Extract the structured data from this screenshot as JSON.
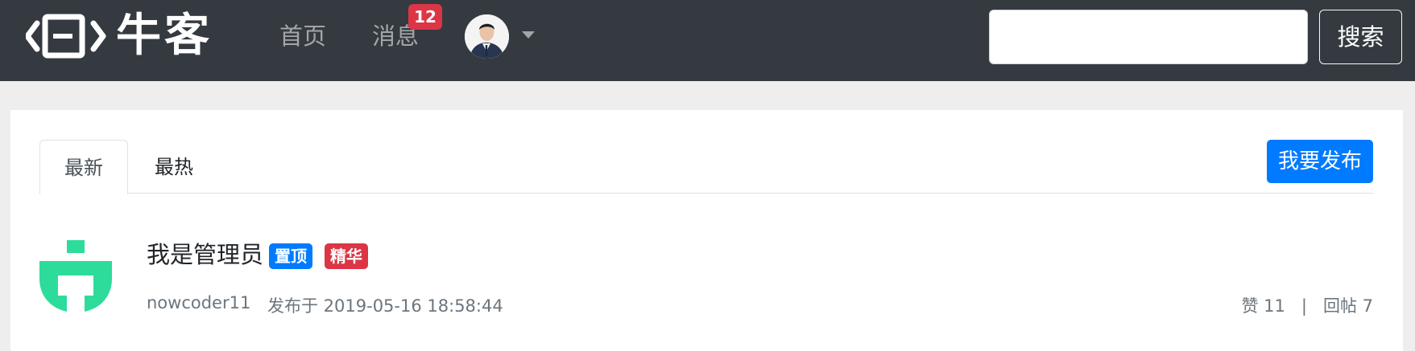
{
  "navbar": {
    "brand_text": "牛客",
    "links": [
      {
        "label": "首页"
      },
      {
        "label": "消息",
        "badge": "12"
      }
    ],
    "search": {
      "value": "",
      "placeholder": "",
      "button_label": "搜索"
    }
  },
  "tabs": [
    {
      "label": "最新",
      "active": true
    },
    {
      "label": "最热",
      "active": false
    }
  ],
  "publish_button": "我要发布",
  "post": {
    "title": "我是管理员",
    "tags": [
      "置顶",
      "精华"
    ],
    "author": "nowcoder11",
    "time": "发布于 2019-05-16 18:58:44",
    "likes": "赞 11",
    "separator": "|",
    "replies": "回帖 7"
  },
  "colors": {
    "navbar_bg": "#343a40",
    "primary": "#007bff",
    "danger": "#dc3545",
    "avatar_green": "#2ddc9a"
  }
}
